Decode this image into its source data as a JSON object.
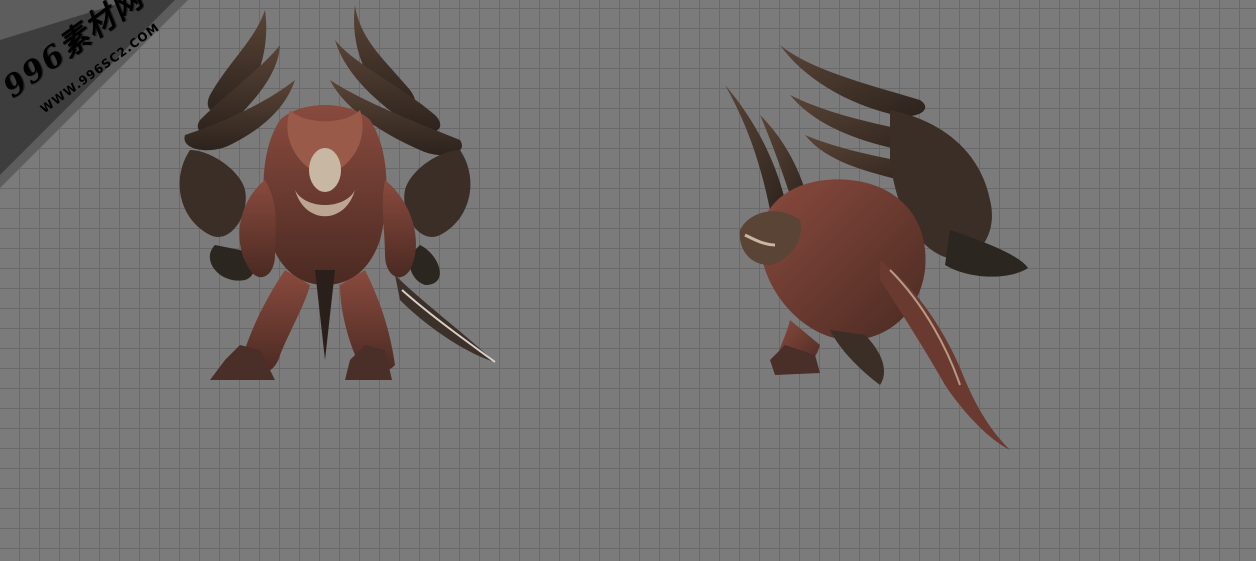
{
  "watermark": {
    "title": "996素材网",
    "url": "WWW.996SC2.COM"
  },
  "scene": {
    "background_color": "#7c7b7b",
    "grid_line_color": "#6a6969",
    "models": [
      {
        "name": "demon-front-view",
        "icon": "demon-creature"
      },
      {
        "name": "demon-side-view",
        "icon": "demon-creature"
      }
    ]
  }
}
